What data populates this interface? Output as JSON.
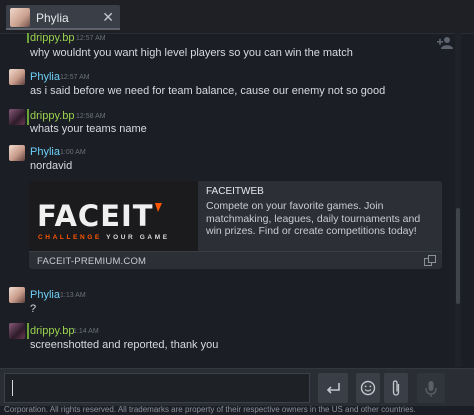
{
  "tab": {
    "name": "Phylia"
  },
  "messages": [
    {
      "sender": "drippy.bp",
      "time": "12:57 AM",
      "text": "why wouldnt you want high level players so you can win the match"
    },
    {
      "sender": "Phylia",
      "time": "12:57 AM",
      "text": "as i said before we need for team balance, cause our enemy not so good"
    },
    {
      "sender": "drippy.bp",
      "time": "12:58 AM",
      "text": "whats your teams name"
    },
    {
      "sender": "Phylia",
      "time": "1:00 AM",
      "text": "nordavid"
    },
    {
      "sender": "Phylia",
      "time": "1:13 AM",
      "text": "?"
    },
    {
      "sender": "drippy.bp",
      "time": "1:14 AM",
      "text": "screenshotted and reported, thank you"
    }
  ],
  "embed": {
    "logo_text": "FACEIT",
    "tagline_highlight": "CHALLENGE",
    "tagline_rest": "YOUR GAME",
    "title": "FACEITWEB",
    "description": "Compete on your favorite games. Join matchmaking, leagues, daily tournaments and win prizes. Find or create competitions today!",
    "url": "FACEIT-PREMIUM.COM"
  },
  "footer": {
    "text": "Corporation. All rights reserved. All trademarks are property of their respective owners in the US and other countries."
  },
  "colors": {
    "accent_green": "#9ad24f",
    "accent_blue": "#6dcff6",
    "brand_orange": "#ff5500"
  },
  "icons": [
    "close-icon",
    "add-friend-icon",
    "send-icon",
    "emoji-icon",
    "attach-icon",
    "voice-icon",
    "expand-icon"
  ]
}
